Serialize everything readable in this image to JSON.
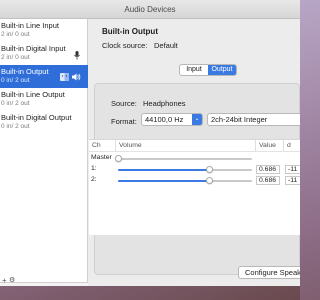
{
  "window": {
    "title": "Audio Devices"
  },
  "sidebar": {
    "devices": [
      {
        "name": "Built-in Line Input",
        "channels": "2 in/ 0 out"
      },
      {
        "name": "Built-in Digital Input",
        "channels": "2 in/ 0 out",
        "icon": "microphone-icon"
      },
      {
        "name": "Built-in Output",
        "channels": "0 in/ 2 out",
        "icon": "finder-speaker-icons",
        "selected": true
      },
      {
        "name": "Built-in Line Output",
        "channels": "0 in/ 2 out"
      },
      {
        "name": "Built-in Digital Output",
        "channels": "0 in/ 2 out"
      }
    ],
    "add_label": "+",
    "settings_icon": "gear-icon"
  },
  "main": {
    "device_title": "Built-in Output",
    "clock_label": "Clock source:",
    "clock_value": "Default",
    "tabs": [
      {
        "label": "Input",
        "selected": false
      },
      {
        "label": "Output",
        "selected": true
      }
    ],
    "source_label": "Source:",
    "source_value": "Headphones",
    "format_label": "Format:",
    "format_rate": "44100,0 Hz",
    "format_bits": "2ch-24bit Integer",
    "table": {
      "headers": {
        "ch": "Ch",
        "volume": "Volume",
        "value": "Value",
        "db": "d"
      },
      "rows": [
        {
          "ch": "Master",
          "level": 0.0,
          "value": "",
          "db": ""
        },
        {
          "ch": "1:",
          "level": 0.686,
          "value": "0.686",
          "db": "-11"
        },
        {
          "ch": "2:",
          "level": 0.686,
          "value": "0.686",
          "db": "-11"
        }
      ]
    },
    "configure_button": "Configure Speakers..."
  },
  "colors": {
    "accent": "#2f6ed9",
    "selected_tab": "#3b7ae3"
  }
}
